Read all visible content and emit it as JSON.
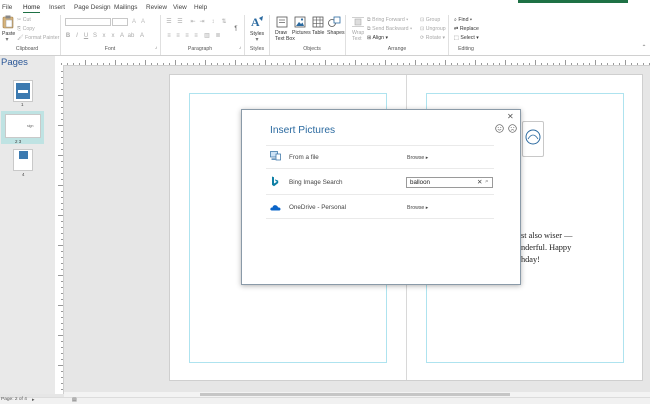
{
  "menu_tabs": [
    "File",
    "Home",
    "Insert",
    "Page Design",
    "Mailings",
    "Review",
    "View",
    "Help"
  ],
  "ribbon": {
    "clipboard": {
      "paste": "Paste",
      "cut": "Cut",
      "copy": "Copy",
      "format_painter": "Format Painter",
      "group": "Clipboard"
    },
    "font_group": "Font",
    "paragraph_group": "Paragraph",
    "styles": {
      "label": "Styles",
      "group": "Styles"
    },
    "objects": {
      "draw_text_box": [
        "Draw",
        "Text Box"
      ],
      "pictures": "Pictures",
      "table": "Table",
      "shapes": "Shapes",
      "group": "Objects"
    },
    "arrange": {
      "wrap_text": [
        "Wrap",
        "Text"
      ],
      "bring_forward": "Bring Forward",
      "send_backward": "Send Backward",
      "align": "Align",
      "group_btn": "Group",
      "ungroup": "Ungroup",
      "rotate": "Rotate",
      "group": "Arrange"
    },
    "editing": {
      "find": "Find",
      "replace": "Replace",
      "select": "Select",
      "group": "Editing"
    }
  },
  "pages_pane": {
    "title": "Pages",
    "thumbnails": [
      "1",
      "2 3",
      "4"
    ],
    "thumb_text": "sign"
  },
  "document": {
    "text_lines": [
      "st also wiser —",
      "nderful.  Happy",
      "hday!"
    ]
  },
  "dialog": {
    "title": "Insert Pictures",
    "rows": [
      {
        "icon": "computer-icon",
        "label": "From a file",
        "action": "Browse"
      },
      {
        "icon": "bing-icon",
        "label": "Bing Image Search",
        "search_value": "balloon"
      },
      {
        "icon": "onedrive-icon",
        "label": "OneDrive - Personal",
        "action": "Browse"
      }
    ]
  },
  "status_bar": {
    "page_info": "Page: 2 of 4"
  },
  "colors": {
    "accent": "#1e7145",
    "dialog_title": "#2b6aa0",
    "pages_title": "#2b5797",
    "margin_guide": "#aee3ef",
    "thumb_selected": "#bfe3e3"
  }
}
